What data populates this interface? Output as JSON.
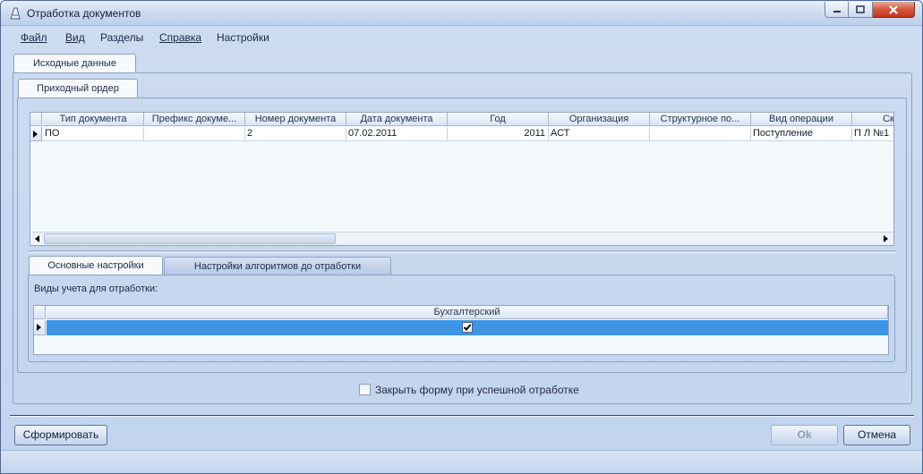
{
  "window": {
    "title": "Отработка документов",
    "icon": "document-process-icon"
  },
  "menu": [
    {
      "label": "Файл"
    },
    {
      "label": "Вид"
    },
    {
      "label": "Разделы"
    },
    {
      "label": "Справка"
    },
    {
      "label": "Настройки"
    }
  ],
  "outer_tab": {
    "label": "Исходные данные"
  },
  "inner_tab": {
    "label": "Приходный ордер"
  },
  "doc_grid": {
    "columns": [
      "Тип документа",
      "Префикс докуме...",
      "Номер документа",
      "Дата документа",
      "Год",
      "Организация",
      "Структурное по...",
      "Вид операции",
      "Ск"
    ],
    "rows": [
      [
        "ПО",
        "",
        "2",
        "07.02.2011",
        "2011",
        "АСТ",
        "",
        "Поступление",
        "П Л №1"
      ]
    ]
  },
  "settings_tabs": [
    {
      "label": "Основные настройки",
      "active": true
    },
    {
      "label": "Настройки алгоритмов до отработки",
      "active": false
    }
  ],
  "settings": {
    "accounting_label": "Виды учета для отработки:",
    "accounting_grid": {
      "columns": [
        "Бухгалтерский"
      ],
      "rows": [
        [
          true
        ]
      ]
    }
  },
  "close_form_checkbox": {
    "label": "Закрыть форму при успешной отработке",
    "checked": false
  },
  "buttons": {
    "generate": "Сформировать",
    "ok": "Ok",
    "cancel": "Отмена"
  },
  "colors": {
    "selection": "#3d95e6",
    "window_bg": "#c2d4ee"
  }
}
